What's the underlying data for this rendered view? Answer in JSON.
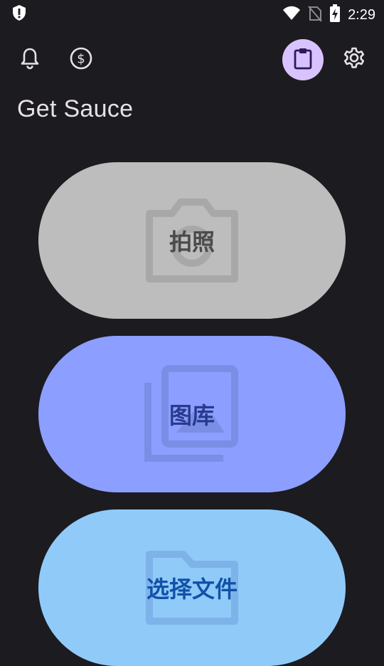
{
  "status_bar": {
    "time": "2:29",
    "icons": [
      "shield-alert-icon",
      "wifi-icon",
      "no-sim-icon",
      "battery-charging-icon"
    ]
  },
  "toolbar": {
    "icons": [
      "bell-icon",
      "dollar-coin-icon",
      "clipboard-icon",
      "settings-gear-icon"
    ],
    "accent": "#d9c3ff"
  },
  "page": {
    "title": "Get Sauce"
  },
  "actions": {
    "camera": {
      "label": "拍照",
      "icon": "camera-icon",
      "color": "#bdbdbd"
    },
    "gallery": {
      "label": "图库",
      "icon": "photo-library-icon",
      "color": "#8c9eff"
    },
    "file": {
      "label": "选择文件",
      "icon": "folder-icon",
      "color": "#90caf9"
    }
  }
}
